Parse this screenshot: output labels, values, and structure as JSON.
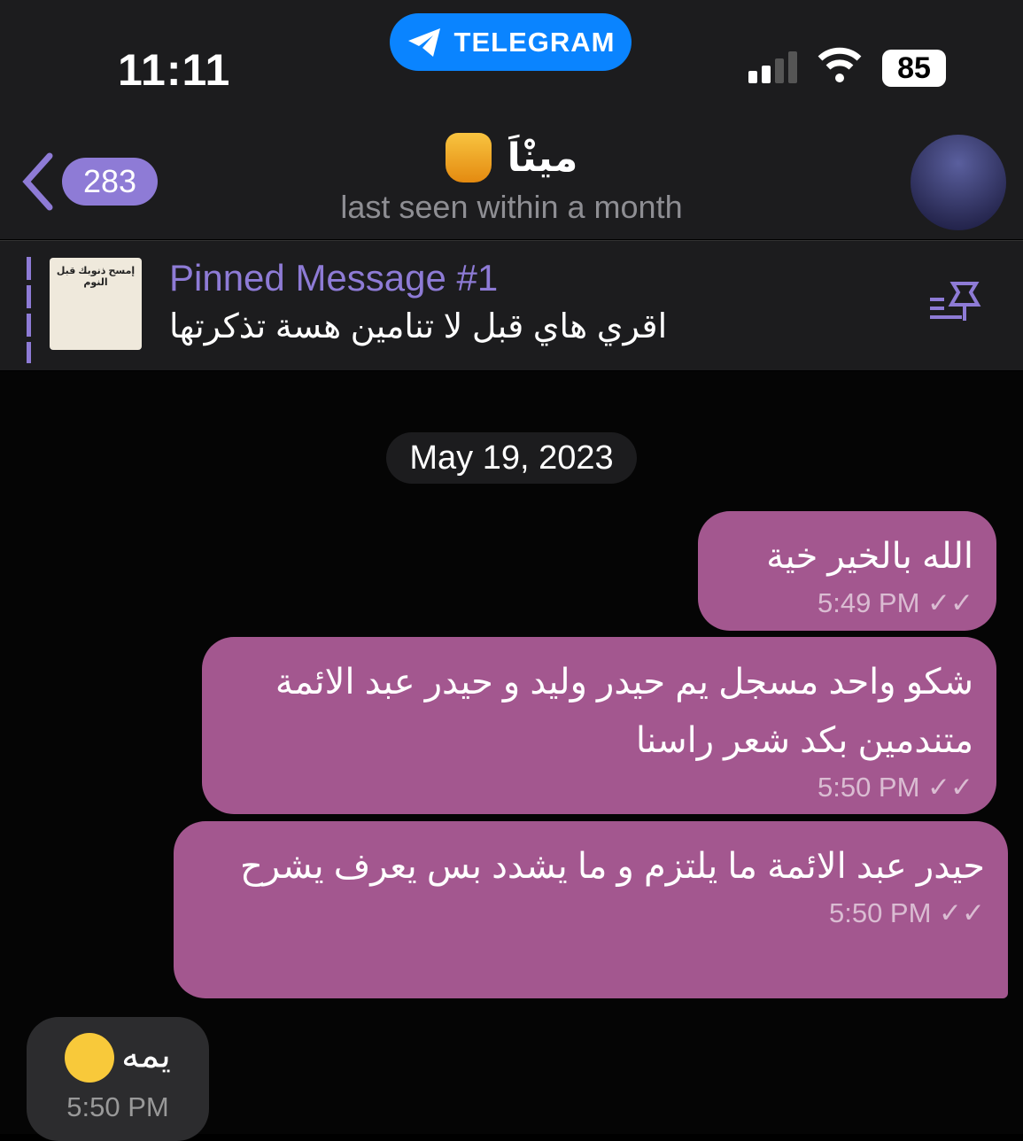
{
  "status": {
    "time": "11:11",
    "app_badge": "TELEGRAM",
    "battery": "85"
  },
  "header": {
    "back_count": "283",
    "name": "مينْاَ",
    "subtitle": "last seen within a month"
  },
  "pinned": {
    "title": "Pinned Message #1",
    "text": "اقري هاي قبل لا تنامين هسة تذكرتها",
    "thumb_caption": "إمسح ذنوبك قبل النوم"
  },
  "chat": {
    "date": "May 19, 2023",
    "messages": [
      {
        "text": "الله بالخير خية",
        "time": "5:49 PM"
      },
      {
        "text": "شكو واحد مسجل يم حيدر وليد و حيدر عبد الائمة متندمين بكد شعر راسنا",
        "time": "5:50 PM"
      },
      {
        "text": "حيدر عبد الائمة ما يلتزم و ما يشدد بس يعرف يشرح",
        "time": "5:50 PM"
      },
      {
        "text": "يمه",
        "time": "5:50 PM"
      }
    ]
  },
  "colors": {
    "accent": "#8e7bd6",
    "outgoing": "#a3578f",
    "telegram": "#0a84ff"
  }
}
